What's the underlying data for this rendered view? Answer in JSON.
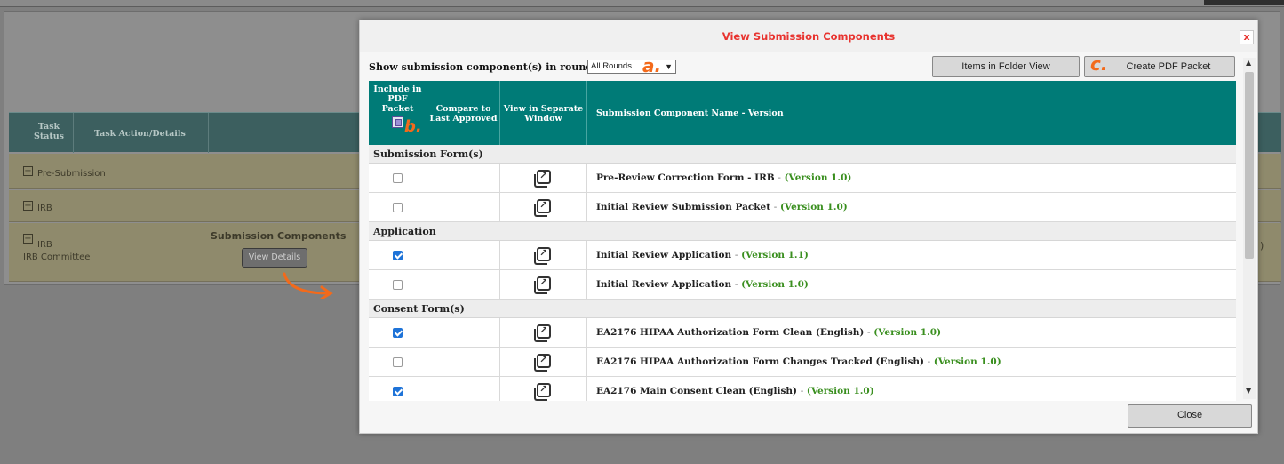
{
  "background": {
    "headers": {
      "task_status": "Task Status",
      "task_action": "Task Action/Details"
    },
    "rows": [
      {
        "label": "Pre-Submission"
      },
      {
        "label": "IRB"
      },
      {
        "label": "IRB",
        "sub": "IRB Committee"
      }
    ],
    "submission_components": "Submission Components",
    "view_details": "View Details",
    "right_glyph": ")"
  },
  "modal": {
    "title": "View Submission Components",
    "close_x": "x",
    "round_label": "Show submission component(s) in round:",
    "round_value": "All Rounds",
    "annotations": {
      "a": "a.",
      "b": "b.",
      "c": "c."
    },
    "buttons": {
      "folder_view": "Items in Folder View",
      "create_pdf": "Create PDF Packet",
      "close": "Close"
    },
    "columns": {
      "include": "Include in PDF Packet",
      "compare": "Compare to Last Approved",
      "view_separate": "View in Separate Window",
      "name": "Submission Component Name - Version"
    },
    "sections": [
      {
        "title": "Submission Form(s)",
        "rows": [
          {
            "name": "Pre-Review Correction Form - IRB",
            "version": "(Version 1.0)",
            "checked": false
          },
          {
            "name": "Initial Review Submission Packet",
            "version": "(Version 1.0)",
            "checked": false
          }
        ]
      },
      {
        "title": "Application",
        "rows": [
          {
            "name": "Initial Review Application",
            "version": "(Version 1.1)",
            "checked": true
          },
          {
            "name": "Initial Review Application",
            "version": "(Version 1.0)",
            "checked": false
          }
        ]
      },
      {
        "title": "Consent Form(s)",
        "rows": [
          {
            "name": "EA2176 HIPAA Authorization Form Clean (English)",
            "version": "(Version 1.0)",
            "checked": true
          },
          {
            "name": "EA2176 HIPAA Authorization Form Changes Tracked (English)",
            "version": "(Version 1.0)",
            "checked": false
          },
          {
            "name": "EA2176 Main Consent Clean (English)",
            "version": "(Version 1.0)",
            "checked": true
          }
        ]
      }
    ],
    "colors": {
      "header_teal": "#007b77",
      "title_red": "#e8332f",
      "version_green": "#3a8f1f",
      "annotation_orange": "#f36a1b"
    },
    "icons": {
      "external": "open-in-new-window-icon",
      "pdf": "pdf-packet-icon"
    }
  }
}
